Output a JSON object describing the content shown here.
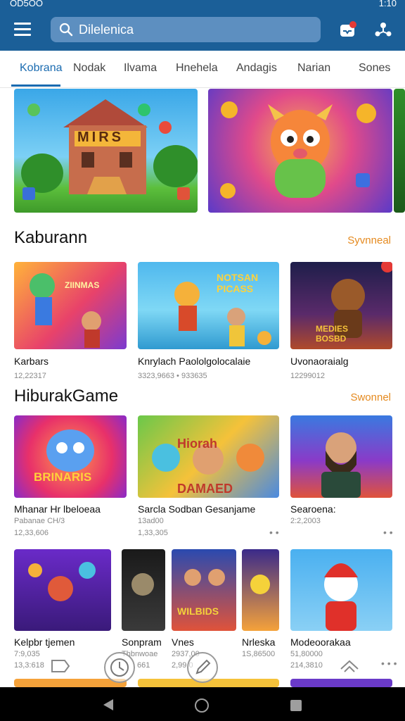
{
  "status_bar": {
    "left_text": "OD5OO",
    "right_text": "1:10"
  },
  "app_bar": {
    "search_value": "Dilelenica",
    "notification_count": "1"
  },
  "tabs": [
    {
      "label": "Kobrana",
      "active": true
    },
    {
      "label": "Nodak"
    },
    {
      "label": "Ilvama"
    },
    {
      "label": "Hnehela"
    },
    {
      "label": "Andagis"
    },
    {
      "label": "Narian"
    },
    {
      "label": "Sones"
    }
  ],
  "banners": [
    {
      "art_title": "MIRS",
      "icon": "castle-art-icon"
    },
    {
      "art_title": "",
      "icon": "monster-mascot-art-icon"
    }
  ],
  "section1": {
    "title": "Kaburann",
    "see_all": "Syvnneal",
    "cards": [
      {
        "title": "Karbars",
        "sub": "12,22317",
        "art": "ZIINMAS"
      },
      {
        "title": "Knrylach Paololgolocalaie",
        "sub": "3323,9663 • 933635",
        "art": "NOTSAN PICASS"
      },
      {
        "title": "Uvonaoraialg",
        "sub": "12299012",
        "art": "MEDIES BOSBD"
      }
    ]
  },
  "section2": {
    "title": "HiburakGame",
    "see_all": "Swonnel",
    "cards": [
      {
        "title": "Mhanar Hr lbeloeaa",
        "sub": "Pabanae CH/3",
        "sub2": "12,33,606",
        "art": "BRINARIS"
      },
      {
        "title": "Sarcla Sodban Gesanjame",
        "sub": "13ad00",
        "sub2": "1,33,305",
        "art": "Hiorah DAMAED"
      },
      {
        "title": "Searoena:",
        "sub": "2:2,2003",
        "art": ""
      }
    ]
  },
  "row3": {
    "cards": [
      {
        "title": "Kelpbr tjemen",
        "sub": "7:9,035",
        "sub2": "13,3:618"
      },
      {
        "title": "Sonpram",
        "sub": "Thbnwoae",
        "sub2": "661"
      },
      {
        "title": "Vnes",
        "sub": "2937,00",
        "sub2": "2,99,0",
        "art": "WILBIDS"
      },
      {
        "title": "Nrleska",
        "sub": "1S,86500"
      },
      {
        "title": "Modeoorakaa",
        "sub": "51,80000",
        "sub2": "214,3810"
      }
    ]
  },
  "colors": {
    "primary": "#1b5f98",
    "accent": "#e58a1f",
    "tab_active": "#1a6bb0"
  }
}
